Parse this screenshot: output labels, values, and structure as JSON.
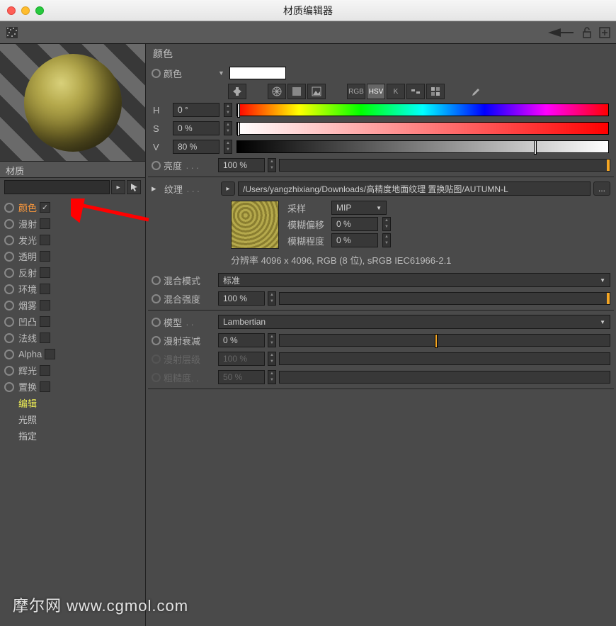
{
  "window": {
    "title": "材质编辑器"
  },
  "sidebar": {
    "material_label": "材质",
    "items": [
      {
        "label": "颜色",
        "checked": true,
        "active": true
      },
      {
        "label": "漫射",
        "checked": false
      },
      {
        "label": "发光",
        "checked": false
      },
      {
        "label": "透明",
        "checked": false
      },
      {
        "label": "反射",
        "checked": false
      },
      {
        "label": "环境",
        "checked": false
      },
      {
        "label": "烟雾",
        "checked": false
      },
      {
        "label": "凹凸",
        "checked": false
      },
      {
        "label": "法线",
        "checked": false
      },
      {
        "label": "Alpha",
        "checked": false
      },
      {
        "label": "辉光",
        "checked": false
      },
      {
        "label": "置换",
        "checked": false
      }
    ],
    "sub_items": [
      "编辑",
      "光照",
      "指定"
    ]
  },
  "color": {
    "heading": "颜色",
    "color_label": "颜色",
    "swatch": "#ffffff",
    "mode_buttons": [
      "RGB",
      "HSV",
      "K"
    ],
    "mode_selected": "HSV",
    "hsv": [
      {
        "key": "H",
        "val": "0 °",
        "grad": "grad-h",
        "marker": 0
      },
      {
        "key": "S",
        "val": "0 %",
        "grad": "grad-s",
        "marker": 0
      },
      {
        "key": "V",
        "val": "80 %",
        "grad": "grad-v",
        "marker": 80
      }
    ],
    "brightness": {
      "label": "亮度",
      "val": "100 %"
    },
    "texture": {
      "label": "纹理",
      "path": "/Users/yangzhixiang/Downloads/高精度地面纹理 置换贴图/AUTUMN-L",
      "sampling_label": "采样",
      "sampling_val": "MIP",
      "blur_offset_label": "模糊偏移",
      "blur_offset_val": "0 %",
      "blur_scale_label": "模糊程度",
      "blur_scale_val": "0 %",
      "info": "分辨率 4096 x 4096, RGB (8 位), sRGB IEC61966-2.1"
    },
    "mix_mode": {
      "label": "混合模式",
      "val": "标准"
    },
    "mix_strength": {
      "label": "混合强度",
      "val": "100 %"
    },
    "model": {
      "label": "模型",
      "val": "Lambertian"
    },
    "falloff": {
      "label": "漫射衰减",
      "val": "0 %",
      "marker": 47
    },
    "level": {
      "label": "漫射层级",
      "val": "100 %"
    },
    "rough": {
      "label": "粗糙度. .",
      "val": "50 %"
    }
  },
  "watermark": "摩尔网 www.cgmol.com"
}
